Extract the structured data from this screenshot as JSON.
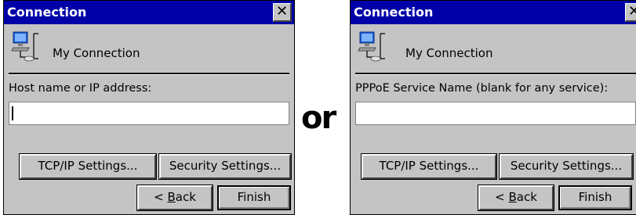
{
  "separator_word": "or",
  "dialogs": [
    {
      "title": "Connection",
      "close_glyph": "✕",
      "connection_name": "My Connection",
      "field_label": "Host name or IP address:",
      "field_value": "",
      "buttons": {
        "tcpip": "TCP/IP Settings...",
        "security": "Security Settings...",
        "back_prefix": "< ",
        "back_mnemonic": "B",
        "back_rest": "ack",
        "finish": "Finish"
      },
      "icon": "network-connection-icon"
    },
    {
      "title": "Connection",
      "close_glyph": "✕",
      "connection_name": "My Connection",
      "field_label": "PPPoE Service Name (blank for any service):",
      "field_value": "",
      "buttons": {
        "tcpip": "TCP/IP Settings...",
        "security": "Security Settings...",
        "back_prefix": "< ",
        "back_mnemonic": "B",
        "back_rest": "ack",
        "finish": "Finish"
      },
      "icon": "network-connection-icon"
    }
  ],
  "colors": {
    "titlebar": "#0000a8",
    "dialog_bg": "#c4c4c4"
  }
}
